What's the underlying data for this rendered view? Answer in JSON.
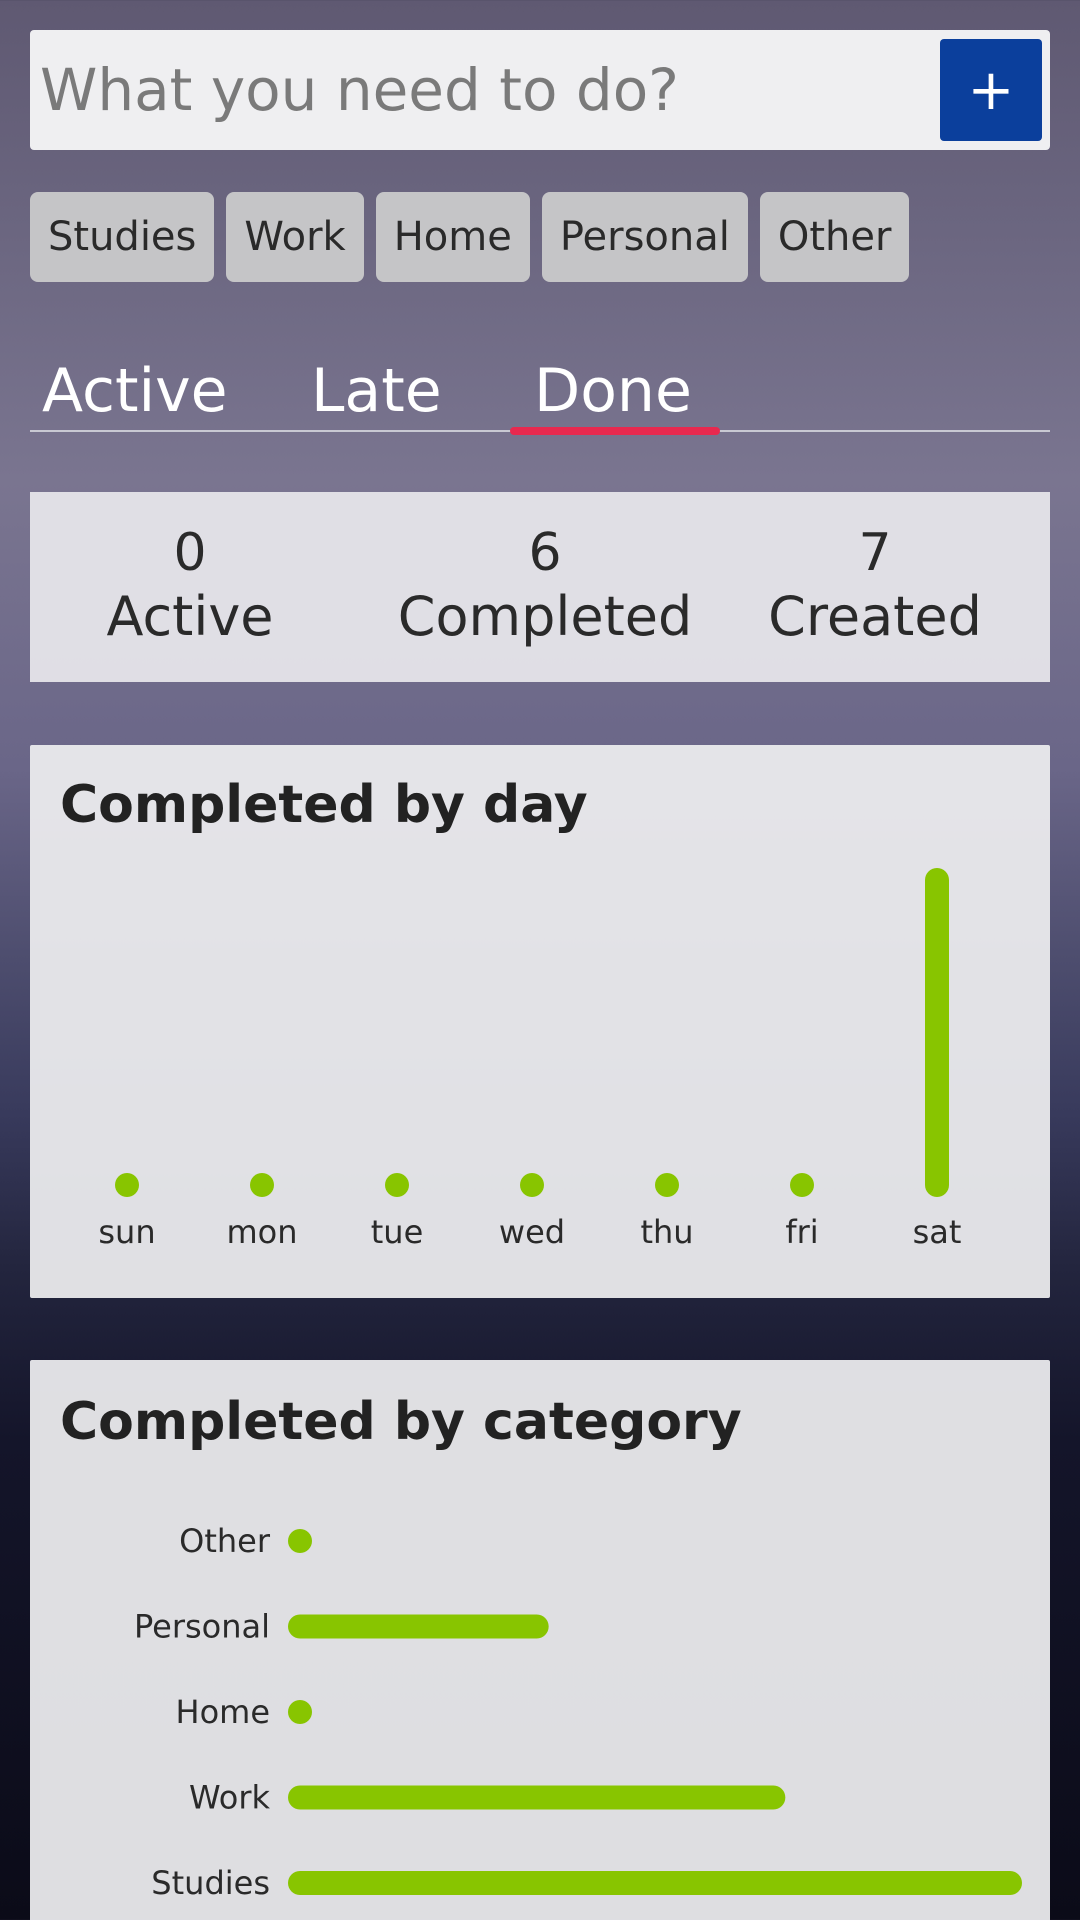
{
  "input": {
    "placeholder": "What you need to do?",
    "value": ""
  },
  "add_button": {
    "label": "+"
  },
  "categories": [
    "Studies",
    "Work",
    "Home",
    "Personal",
    "Other"
  ],
  "tabs": [
    {
      "label": "Active",
      "selected": false
    },
    {
      "label": "Late",
      "selected": false
    },
    {
      "label": "Done",
      "selected": true
    }
  ],
  "stats": [
    {
      "value": "0",
      "label": "Active"
    },
    {
      "value": "6",
      "label": "Completed"
    },
    {
      "value": "7",
      "label": "Created"
    }
  ],
  "colors": {
    "accent": "#0b3f9c",
    "bar": "#88c500",
    "tab_indicator": "#e8294f"
  },
  "chart_data": [
    {
      "type": "bar",
      "orientation": "vertical",
      "title": "Completed by day",
      "categories": [
        "sun",
        "mon",
        "tue",
        "wed",
        "thu",
        "fri",
        "sat"
      ],
      "values": [
        0,
        0,
        0,
        0,
        0,
        0,
        6
      ],
      "xlabel": "",
      "ylabel": "",
      "grid": false
    },
    {
      "type": "bar",
      "orientation": "horizontal",
      "title": "Completed by category",
      "categories": [
        "Other",
        "Personal",
        "Home",
        "Work",
        "Studies"
      ],
      "values": [
        0,
        1,
        0,
        2,
        3
      ],
      "xlabel": "",
      "ylabel": "",
      "grid": false
    }
  ]
}
